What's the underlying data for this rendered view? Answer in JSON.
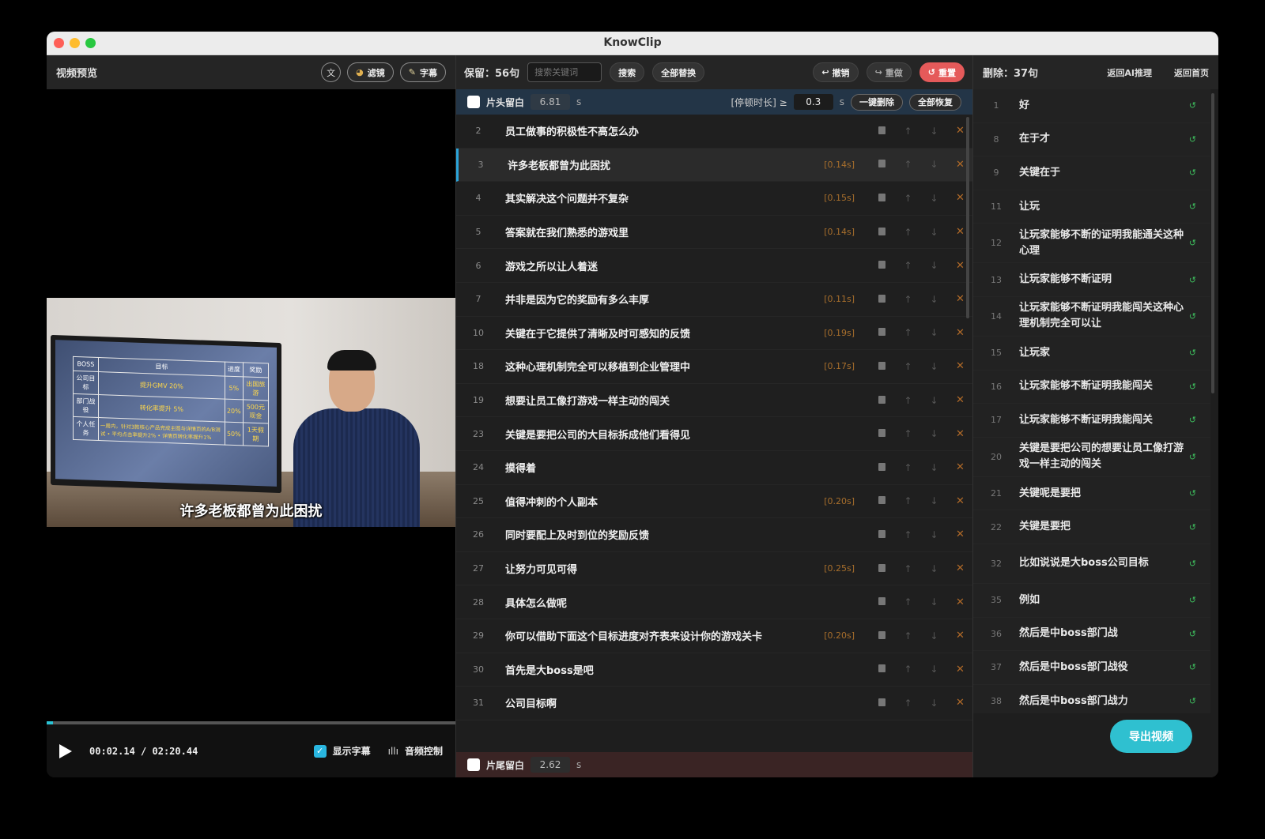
{
  "window": {
    "title": "KnowClip"
  },
  "preview": {
    "title": "视频预览",
    "lang_label": "文",
    "filter_label": "滤镜",
    "subtitle_btn_label": "字幕",
    "subtitle_text": "许多老板都曾为此困扰",
    "current_time": "00:02.14",
    "time_separator": "/",
    "total_time": "02:20.44",
    "progress_fraction": 0.015,
    "show_subtitles_label": "显示字幕",
    "show_subtitles_checked": true,
    "audio_control_label": "音频控制",
    "tv_table": [
      [
        "BOSS",
        "目标",
        "进度",
        "奖励"
      ],
      [
        "公司目标",
        "提升GMV 20%",
        "5%",
        "出国旅游"
      ],
      [
        "部门战役",
        "转化率提升 5%",
        "20%",
        "500元现金"
      ],
      [
        "个人任务",
        "一周内，针对3款核心产品完成主图与详情页的A/B测试 • 平均点击率提升2% • 详情页转化率提升1%",
        "50%",
        "1天假期"
      ]
    ]
  },
  "editor": {
    "keep_label": "保留：56句",
    "search_placeholder": "搜索关键词",
    "search_btn": "搜索",
    "replace_all_btn": "全部替换",
    "undo_btn": "撤销",
    "redo_btn": "重做",
    "reset_btn": "重置",
    "head_label": "片头留白",
    "head_value": "6.81",
    "unit_s": "s",
    "pause_label": "[停顿时长] ≥",
    "pause_value": "0.3",
    "one_click_delete": "一键删除",
    "restore_all": "全部恢复",
    "tail_label": "片尾留白",
    "tail_value": "2.62",
    "rows": [
      {
        "n": "2",
        "text": "员工做事的积极性不高怎么办",
        "pause": ""
      },
      {
        "n": "3",
        "text": "许多老板都曾为此困扰",
        "pause": "[0.14s]",
        "active": true
      },
      {
        "n": "4",
        "text": "其实解决这个问题并不复杂",
        "pause": "[0.15s]"
      },
      {
        "n": "5",
        "text": "答案就在我们熟悉的游戏里",
        "pause": "[0.14s]"
      },
      {
        "n": "6",
        "text": "游戏之所以让人着迷",
        "pause": ""
      },
      {
        "n": "7",
        "text": "并非是因为它的奖励有多么丰厚",
        "pause": "[0.11s]"
      },
      {
        "n": "10",
        "text": "关键在于它提供了清晰及时可感知的反馈",
        "pause": "[0.19s]"
      },
      {
        "n": "18",
        "text": "这种心理机制完全可以移植到企业管理中",
        "pause": "[0.17s]"
      },
      {
        "n": "19",
        "text": "想要让员工像打游戏一样主动的闯关",
        "pause": ""
      },
      {
        "n": "23",
        "text": "关键是要把公司的大目标拆成他们看得见",
        "pause": ""
      },
      {
        "n": "24",
        "text": "摸得着",
        "pause": ""
      },
      {
        "n": "25",
        "text": "值得冲刺的个人副本",
        "pause": "[0.20s]"
      },
      {
        "n": "26",
        "text": "同时要配上及时到位的奖励反馈",
        "pause": ""
      },
      {
        "n": "27",
        "text": "让努力可见可得",
        "pause": "[0.25s]"
      },
      {
        "n": "28",
        "text": "具体怎么做呢",
        "pause": ""
      },
      {
        "n": "29",
        "text": "你可以借助下面这个目标进度对齐表来设计你的游戏关卡",
        "pause": "[0.20s]"
      },
      {
        "n": "30",
        "text": "首先是大boss是吧",
        "pause": ""
      },
      {
        "n": "31",
        "text": "公司目标啊",
        "pause": ""
      }
    ]
  },
  "deleted": {
    "label": "删除：37句",
    "back_ai": "返回AI推理",
    "back_home": "返回首页",
    "export_btn": "导出视频",
    "items": [
      {
        "n": "1",
        "text": "好"
      },
      {
        "n": "8",
        "text": "在于才"
      },
      {
        "n": "9",
        "text": "关键在于"
      },
      {
        "n": "11",
        "text": "让玩"
      },
      {
        "n": "12",
        "text": "让玩家能够不断的证明我能通关这种心理"
      },
      {
        "n": "13",
        "text": "让玩家能够不断证明"
      },
      {
        "n": "14",
        "text": "让玩家能够不断证明我能闯关这种心理机制完全可以让"
      },
      {
        "n": "15",
        "text": "让玩家"
      },
      {
        "n": "16",
        "text": "让玩家能够不断证明我能闯关"
      },
      {
        "n": "17",
        "text": "让玩家能够不断证明我能闯关"
      },
      {
        "n": "20",
        "text": "关键是要把公司的想要让员工像打游戏一样主动的闯关"
      },
      {
        "n": "21",
        "text": "关键呢是要把"
      },
      {
        "n": "22",
        "text": "关键是要把"
      },
      {
        "n": "32",
        "text": "比如说说是大boss公司目标"
      },
      {
        "n": "35",
        "text": "例如"
      },
      {
        "n": "36",
        "text": "然后是中boss部门战"
      },
      {
        "n": "37",
        "text": "然后是中boss部门战役"
      },
      {
        "n": "38",
        "text": "然后是中boss部门战力"
      }
    ]
  }
}
